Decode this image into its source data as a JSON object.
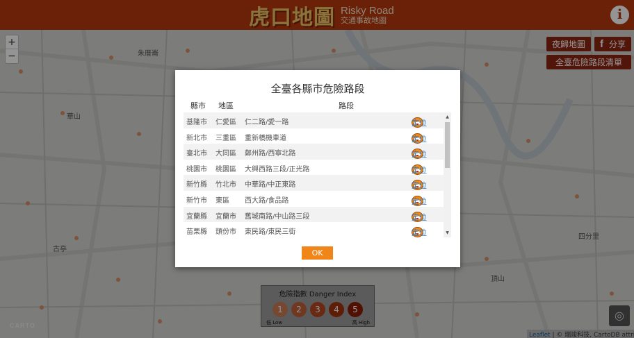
{
  "header": {
    "logo_cn": "虎口地圖",
    "logo_en": "Risky Road",
    "logo_sub": "交通事故地圖",
    "info_label": "i"
  },
  "map": {
    "zoom_in": "+",
    "zoom_out": "−",
    "labels": [
      "朱厝崙",
      "華山",
      "古亭",
      "四分里",
      "大坪林",
      "頂山"
    ],
    "carto": "CARTO",
    "attribution_leaflet": "Leaflet",
    "attribution_sep": " | © ",
    "attribution_rest": "瑞竣科技, CartoDB attribution"
  },
  "toolbar": {
    "night_label": "夜歸地圖",
    "share_icon_label": "f",
    "share_label": "分享",
    "list_label": "全臺危險路段清單"
  },
  "legend": {
    "title": "危險指數 Danger Index",
    "levels": [
      "1",
      "2",
      "3",
      "4",
      "5"
    ],
    "colors": [
      "#cc7a55",
      "#c2603a",
      "#b6481f",
      "#a3320d",
      "#8a1e04"
    ],
    "low": "低 Low",
    "high": "高 High"
  },
  "modal": {
    "title": "全臺各縣市危險路段",
    "headers": {
      "county": "縣市",
      "district": "地區",
      "road": "路段"
    },
    "locate_label": "定位",
    "ok_label": "OK",
    "rows": [
      {
        "county": "基隆市",
        "district": "仁愛區",
        "road": "仁二路/愛一路"
      },
      {
        "county": "新北市",
        "district": "三重區",
        "road": "重新橋機車道"
      },
      {
        "county": "臺北市",
        "district": "大同區",
        "road": "鄭州路/西寧北路"
      },
      {
        "county": "桃園市",
        "district": "桃園區",
        "road": "大興西路三段/正光路"
      },
      {
        "county": "新竹縣",
        "district": "竹北市",
        "road": "中華路/中正東路"
      },
      {
        "county": "新竹市",
        "district": "東區",
        "road": "西大路/食品路"
      },
      {
        "county": "宜蘭縣",
        "district": "宜蘭市",
        "road": "舊城南路/中山路三段"
      },
      {
        "county": "苗栗縣",
        "district": "頭份市",
        "road": "東民路/東民三街"
      }
    ]
  }
}
